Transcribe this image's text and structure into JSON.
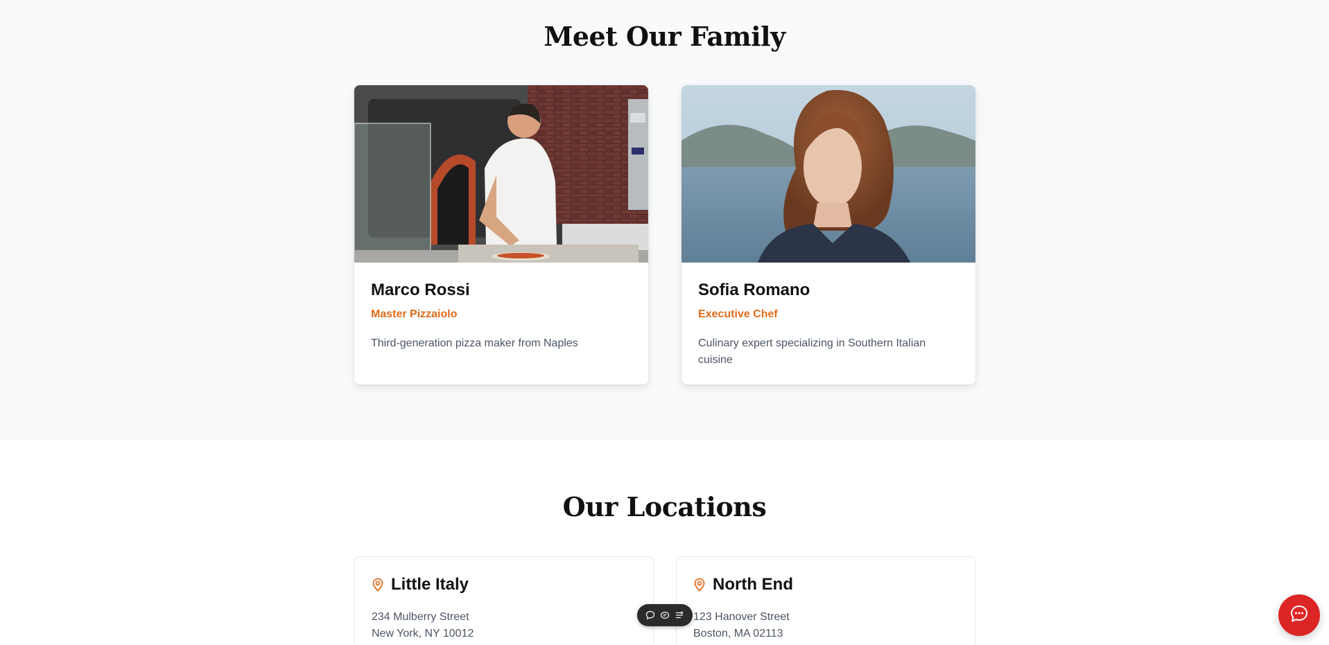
{
  "family": {
    "title": "Meet Our Family",
    "members": [
      {
        "name": "Marco Rossi",
        "role": "Master Pizzaiolo",
        "bio": "Third-generation pizza maker from Naples"
      },
      {
        "name": "Sofia Romano",
        "role": "Executive Chef",
        "bio": "Culinary expert specializing in Southern Italian cuisine"
      }
    ]
  },
  "locations": {
    "title": "Our Locations",
    "items": [
      {
        "name": "Little Italy",
        "address_line1": "234 Mulberry Street",
        "address_line2": "New York, NY 10012"
      },
      {
        "name": "North End",
        "address_line1": "123 Hanover Street",
        "address_line2": "Boston, MA 02113"
      }
    ]
  },
  "icons": {
    "location": "map-pin-icon",
    "toolbar": [
      "comment-icon",
      "chat-bubble-icon",
      "list-settings-icon"
    ],
    "chat": "chat-icon"
  },
  "colors": {
    "accent": "#e06b1a",
    "chat_button": "#dc2626",
    "section_bg": "#f9fafb",
    "toolbar_bg": "#2b2b2b"
  }
}
